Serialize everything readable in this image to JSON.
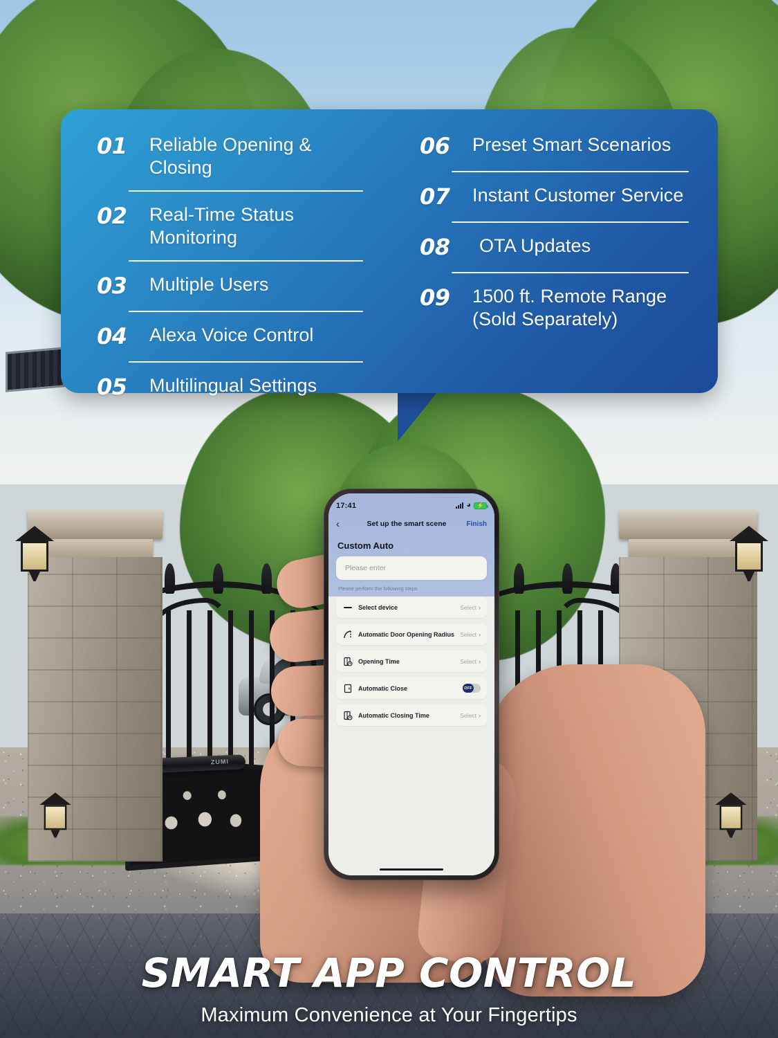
{
  "feature_card": {
    "left_column": [
      {
        "number": "01",
        "text": "Reliable Opening & Closing"
      },
      {
        "number": "02",
        "text": "Real-Time Status Monitoring"
      },
      {
        "number": "03",
        "text": "Multiple Users"
      },
      {
        "number": "04",
        "text": "Alexa Voice Control"
      },
      {
        "number": "05",
        "text": "Multilingual Settings"
      }
    ],
    "right_column": [
      {
        "number": "06",
        "text": "Preset Smart Scenarios"
      },
      {
        "number": "07",
        "text": "Instant Customer Service"
      },
      {
        "number": "08",
        "text": "OTA Updates"
      },
      {
        "number": "09",
        "text": "1500 ft. Remote Range\n(Sold Separately)"
      }
    ],
    "colors": {
      "gradient_start": "#2fa0d6",
      "gradient_end": "#1c4a97",
      "divider": "#ffffff",
      "text": "#ffffff"
    }
  },
  "phone": {
    "status_bar": {
      "time": "17:41",
      "signal_icon": "cellular-signal-icon",
      "wifi_icon": "wifi-icon",
      "battery_icon": "battery-charging-icon",
      "battery_color": "#34c759"
    },
    "nav": {
      "back_icon": "chevron-left-icon",
      "title": "Set up the smart scene",
      "finish_label": "Finish",
      "finish_color": "#1f4fa8"
    },
    "scene_name_label": "Custom Auto",
    "name_input": {
      "placeholder": "Please enter",
      "value": ""
    },
    "steps_hint": "Please perform the following steps",
    "steps": [
      {
        "icon": "minus-line-icon",
        "label": "Select device",
        "control": "select",
        "value": "Select",
        "chevron": "›"
      },
      {
        "icon": "arc-radius-icon",
        "label": "Automatic Door Opening Radius",
        "control": "select",
        "value": "Select",
        "chevron": "›"
      },
      {
        "icon": "door-clock-open-icon",
        "label": "Opening Time",
        "control": "select",
        "value": "Select",
        "chevron": "›"
      },
      {
        "icon": "door-icon",
        "label": "Automatic Close",
        "control": "toggle",
        "value": "OFF",
        "chevron": ""
      },
      {
        "icon": "door-clock-close-icon",
        "label": "Automatic Closing Time",
        "control": "select",
        "value": "Select",
        "chevron": "›"
      }
    ],
    "home_indicator": "home-indicator"
  },
  "bottom": {
    "headline": "SMART APP CONTROL",
    "subhead": "Maximum Convenience at Your Fingertips"
  }
}
